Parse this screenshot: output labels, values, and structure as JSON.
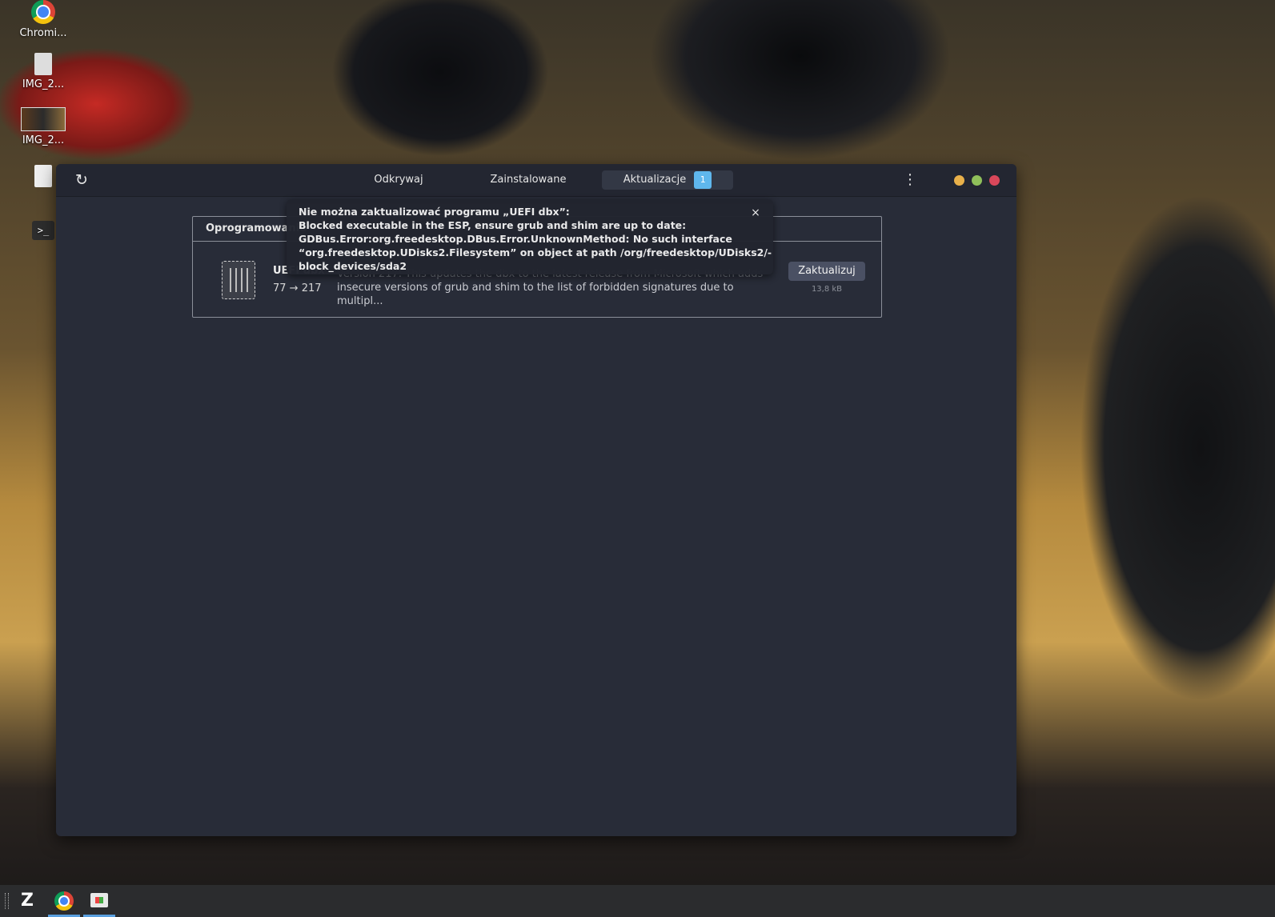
{
  "desktop": {
    "icons": [
      {
        "label": "Chromi...",
        "icon": "chrome-icon"
      },
      {
        "label": "IMG_2...",
        "icon": "image-file-icon"
      },
      {
        "label": "IMG_2...",
        "icon": "image-file-icon"
      },
      {
        "label": "",
        "icon": "text-file-icon"
      },
      {
        "label": "",
        "icon": "terminal-icon"
      }
    ]
  },
  "window": {
    "refresh_icon": "↻",
    "tabs": [
      {
        "label": "Odkrywaj"
      },
      {
        "label": "Zainstalowane"
      },
      {
        "label": "Aktualizacje",
        "badge": "1"
      }
    ],
    "menu_icon": "⋮",
    "controls": {
      "minimize_color": "#e8b04a",
      "maximize_color": "#8fbf5a",
      "close_color": "#d9475a"
    }
  },
  "updates_panel": {
    "title": "Oprogramowanie",
    "app": {
      "name": "UEFI dbx",
      "version": "77 → 217",
      "description_line1": "Version 217: This updates the dbx to the latest release from Microsoft which adds",
      "description_line2": "insecure versions of grub and shim to the list of forbidden signatures due to multipl...",
      "update_label": "Zaktualizuj",
      "size": "13,8 kB"
    }
  },
  "error_toast": {
    "lines": [
      "Nie można zaktualizować programu „UEFI dbx”:",
      "Blocked executable in the ESP, ensure grub and shim are up to date:",
      "GDBus.Error:org.freedesktop.DBus.Error.UnknownMethod: No such interface",
      "“org.freedesktop.UDisks2.Filesystem” on object at path /org/freedesktop/UDisks2/-",
      "block_devices/sda2"
    ],
    "close_icon": "×"
  },
  "taskbar": {
    "items": [
      {
        "icon": "zorin-menu-icon"
      },
      {
        "icon": "chrome-icon",
        "active": true
      },
      {
        "icon": "software-store-icon",
        "active": true
      }
    ]
  }
}
